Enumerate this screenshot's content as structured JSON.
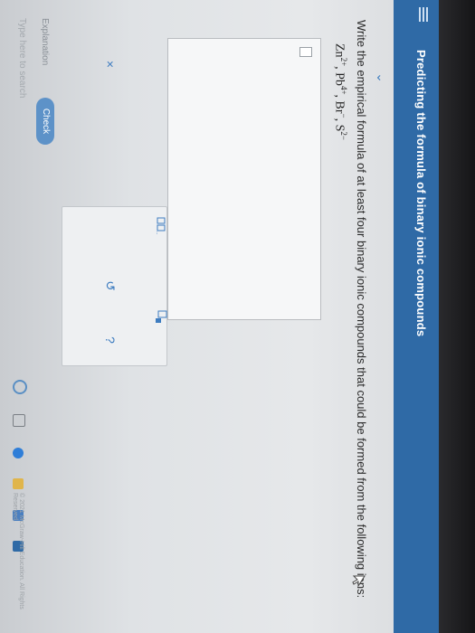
{
  "header": {
    "title": "Predicting the formula of binary ionic compounds"
  },
  "question": {
    "text": "Write the empirical formula of at least four binary ionic compounds that could be formed from the following ions:",
    "ions": [
      {
        "symbol": "Zn",
        "charge": "2+"
      },
      {
        "symbol": "Pb",
        "charge": "4+"
      },
      {
        "symbol": "Br",
        "charge": "−"
      },
      {
        "symbol": "S",
        "charge": "2−"
      }
    ]
  },
  "toolbar": {
    "clear_label": "×",
    "undo_label": "↺",
    "help_label": "?"
  },
  "footer": {
    "explanation_label": "Explanation",
    "check_label": "Check",
    "copyright": "© 2021 McGraw-Hill Education. All Rights Reserved."
  },
  "taskbar": {
    "search_placeholder": "Type here to search"
  },
  "colors": {
    "header_bg": "#2f6aa6",
    "accent": "#3d7cc0",
    "check_bg": "#5d92c8"
  }
}
